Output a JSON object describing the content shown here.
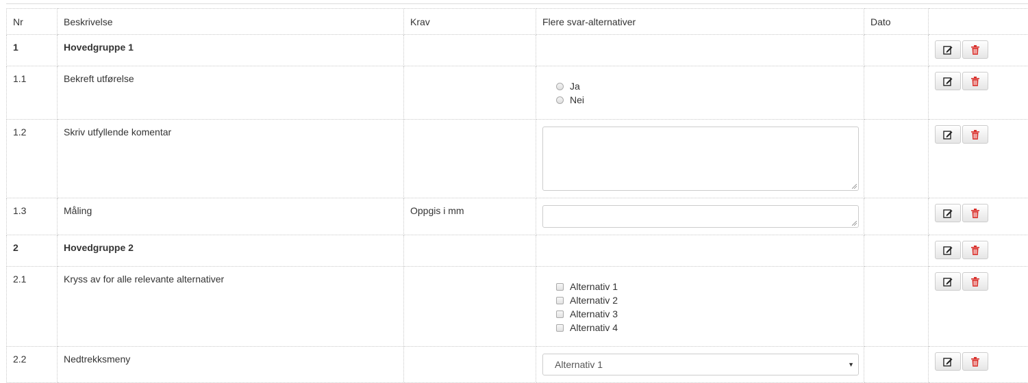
{
  "columns": {
    "nr": "Nr",
    "description": "Beskrivelse",
    "requirement": "Krav",
    "answer_options": "Flere svar-alternativer",
    "date": "Dato"
  },
  "rows": [
    {
      "nr": "1",
      "description": "Hovedgruppe 1",
      "requirement": "",
      "type": "group"
    },
    {
      "nr": "1.1",
      "description": "Bekreft utførelse",
      "requirement": "",
      "type": "radio",
      "options": [
        "Ja",
        "Nei"
      ]
    },
    {
      "nr": "1.2",
      "description": "Skriv utfyllende komentar",
      "requirement": "",
      "type": "textarea"
    },
    {
      "nr": "1.3",
      "description": "Måling",
      "requirement": "Oppgis i mm",
      "type": "text"
    },
    {
      "nr": "2",
      "description": "Hovedgruppe 2",
      "requirement": "",
      "type": "group"
    },
    {
      "nr": "2.1",
      "description": "Kryss av for alle relevante alternativer",
      "requirement": "",
      "type": "checkbox",
      "options": [
        "Alternativ 1",
        "Alternativ 2",
        "Alternativ 3",
        "Alternativ 4"
      ]
    },
    {
      "nr": "2.2",
      "description": "Nedtrekksmeny",
      "requirement": "",
      "type": "select",
      "selected": "Alternativ 1"
    }
  ],
  "icons": {
    "edit": "edit-icon",
    "delete": "trash-icon"
  },
  "colors": {
    "delete_icon": "#d9302b",
    "border": "#c8c8c8"
  }
}
